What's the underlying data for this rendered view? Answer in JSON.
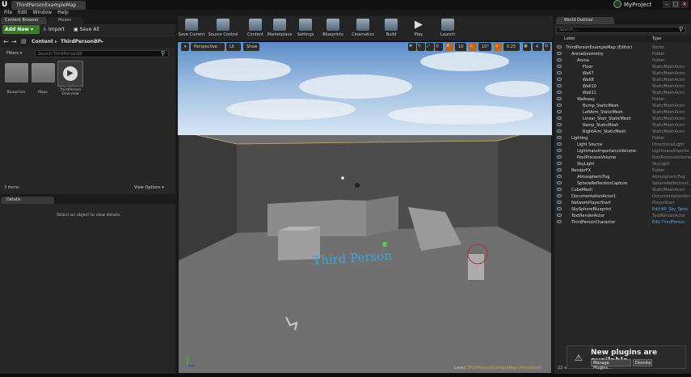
{
  "window": {
    "doc_tab": "ThirdPersonExampleMap",
    "project": "MyProject",
    "minimize": "–",
    "maximize": "□",
    "close": "×"
  },
  "menu": [
    "File",
    "Edit",
    "Window",
    "Help"
  ],
  "tabs": {
    "content_browser": "Content Browser",
    "modes": "Modes",
    "details": "Details",
    "world_outliner": "World Outliner"
  },
  "content_browser": {
    "add_new": "Add New ▾",
    "import": "Import",
    "save_all": "Save All",
    "path": [
      "Content",
      "ThirdPersonBP"
    ],
    "filters": "Filters ▾",
    "search_placeholder": "Search ThirdPersonBP",
    "tiles": [
      {
        "label": "Blueprints"
      },
      {
        "label": "Maps"
      },
      {
        "label": "ThirdPerson Overview"
      }
    ],
    "item_count": "3 items",
    "view_options": "View Options ▾"
  },
  "details": {
    "empty_msg": "Select an object to view details"
  },
  "toolbar": [
    {
      "label": "Save Current",
      "icon": "save-icon"
    },
    {
      "label": "Source Control",
      "icon": "source-control-icon"
    },
    {
      "label": "Content",
      "icon": "content-icon"
    },
    {
      "label": "Marketplace",
      "icon": "marketplace-icon"
    },
    {
      "label": "Settings",
      "icon": "settings-icon"
    },
    {
      "label": "Blueprints",
      "icon": "blueprints-icon"
    },
    {
      "label": "Cinematics",
      "icon": "cinematics-icon"
    },
    {
      "label": "Build",
      "icon": "build-icon"
    },
    {
      "label": "Play",
      "icon": "play-icon"
    },
    {
      "label": "Launch",
      "icon": "launch-icon"
    }
  ],
  "viewport": {
    "perspective": "Perspective",
    "lit": "Lit",
    "show": "Show",
    "grid_snap": "10",
    "rot_snap": "10°",
    "scale_snap": "0.25",
    "cam_speed": "4",
    "world_text": "Third Person",
    "level_label": "Level:",
    "level_name": "ThirdPersonExampleMap (Persistent)"
  },
  "outliner": {
    "search_placeholder": "Search...",
    "col_label": "Label",
    "col_type": "Type",
    "rows": [
      {
        "label": "ThirdPersonExampleMap (Editor)",
        "type": "World",
        "indent": 0,
        "link": false
      },
      {
        "label": "ArenaGeometry",
        "type": "Folder",
        "indent": 1,
        "link": false
      },
      {
        "label": "Arena",
        "type": "Folder",
        "indent": 2,
        "link": false
      },
      {
        "label": "Floor",
        "type": "StaticMeshActor",
        "indent": 3,
        "link": false
      },
      {
        "label": "Wall7",
        "type": "StaticMeshActor",
        "indent": 3,
        "link": false
      },
      {
        "label": "Wall8",
        "type": "StaticMeshActor",
        "indent": 3,
        "link": false
      },
      {
        "label": "Wall10",
        "type": "StaticMeshActor",
        "indent": 3,
        "link": false
      },
      {
        "label": "Wall11",
        "type": "StaticMeshActor",
        "indent": 3,
        "link": false
      },
      {
        "label": "Walkway",
        "type": "Folder",
        "indent": 2,
        "link": false
      },
      {
        "label": "Bump_StaticMesh",
        "type": "StaticMeshActor",
        "indent": 3,
        "link": false
      },
      {
        "label": "LeftArm_StaticMesh",
        "type": "StaticMeshActor",
        "indent": 3,
        "link": false
      },
      {
        "label": "Linear_Stair_StaticMesh",
        "type": "StaticMeshActor",
        "indent": 3,
        "link": false
      },
      {
        "label": "Ramp_StaticMesh",
        "type": "StaticMeshActor",
        "indent": 3,
        "link": false
      },
      {
        "label": "RightArm_StaticMesh",
        "type": "StaticMeshActor",
        "indent": 3,
        "link": false
      },
      {
        "label": "Lighting",
        "type": "Folder",
        "indent": 1,
        "link": false
      },
      {
        "label": "Light Source",
        "type": "DirectionalLight",
        "indent": 2,
        "link": false
      },
      {
        "label": "LightmassImportanceVolume",
        "type": "LightmassImporta",
        "indent": 2,
        "link": false
      },
      {
        "label": "PostProcessVolume",
        "type": "PostProcessVolume",
        "indent": 2,
        "link": false
      },
      {
        "label": "SkyLight",
        "type": "SkyLight",
        "indent": 2,
        "link": false
      },
      {
        "label": "RenderFX",
        "type": "Folder",
        "indent": 1,
        "link": false
      },
      {
        "label": "AtmosphericFog",
        "type": "AtmosphericFog",
        "indent": 2,
        "link": false
      },
      {
        "label": "SphereReflectionCapture",
        "type": "SphereReflectionC",
        "indent": 2,
        "link": false
      },
      {
        "label": "CubeMesh",
        "type": "StaticMeshActor",
        "indent": 1,
        "link": false
      },
      {
        "label": "DocumentationActor1",
        "type": "DocumentationAct",
        "indent": 1,
        "link": false
      },
      {
        "label": "NetworkPlayerStart",
        "type": "PlayerStart",
        "indent": 1,
        "link": false
      },
      {
        "label": "SkySphereBlueprint",
        "type": "Edit BP_Sky_Sphe",
        "indent": 1,
        "link": true
      },
      {
        "label": "TextRenderActor",
        "type": "TextRenderActor",
        "indent": 1,
        "link": false
      },
      {
        "label": "ThirdPersonCharacter",
        "type": "Edit ThirdPerson",
        "indent": 1,
        "link": true
      }
    ],
    "actor_count": "22 a"
  },
  "notification": {
    "message": "New plugins are available",
    "manage": "Manage Plugins...",
    "dismiss": "Dismiss"
  }
}
